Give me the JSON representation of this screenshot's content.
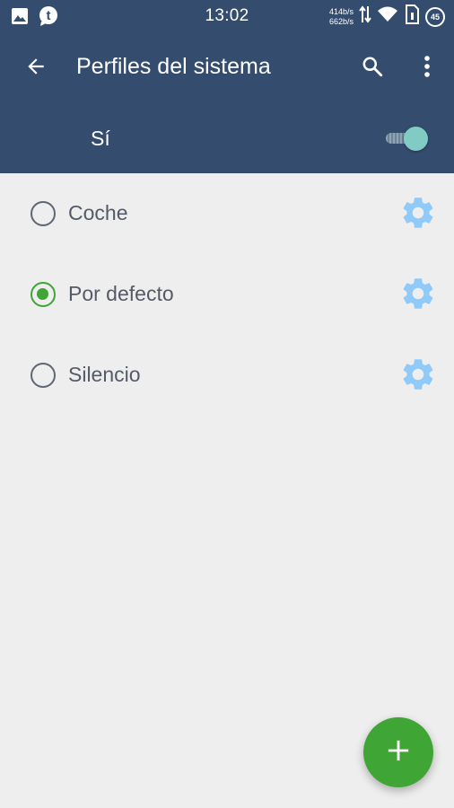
{
  "status_bar": {
    "time": "13:02",
    "up_speed": "414b/s",
    "down_speed": "662b/s",
    "battery": "45",
    "icons": [
      "image-icon",
      "tumblr-icon",
      "data-transfer-icon",
      "wifi-icon",
      "sim-icon",
      "battery-icon"
    ]
  },
  "app_bar": {
    "title": "Perfiles del sistema",
    "icons": [
      "back-arrow-icon",
      "search-icon",
      "more-vert-icon"
    ]
  },
  "toggle": {
    "label": "Sí",
    "on": true
  },
  "profiles": [
    {
      "label": "Coche",
      "selected": false
    },
    {
      "label": "Por defecto",
      "selected": true
    },
    {
      "label": "Silencio",
      "selected": false
    }
  ],
  "fab": {
    "icon": "plus-icon"
  },
  "colors": {
    "primary": "#344d6f",
    "accent": "#3fa535",
    "gear": "#90caf9",
    "switch_thumb": "#80cbc4",
    "background": "#eeeeee",
    "text": "#545a66"
  }
}
